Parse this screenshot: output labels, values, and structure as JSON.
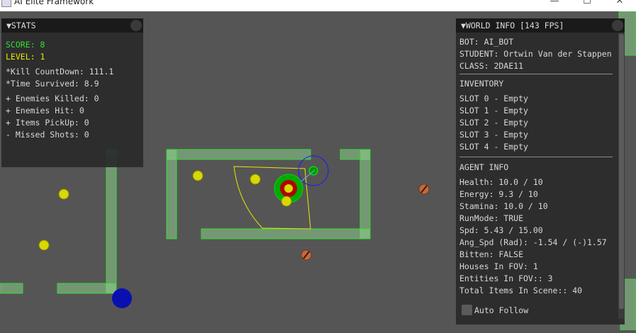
{
  "window": {
    "title": "AI Elite Framework",
    "minimize": "—",
    "maximize": "☐",
    "close": "✕"
  },
  "stats": {
    "header": "▼STATS",
    "score": "SCORE: 8",
    "level": "LEVEL: 1",
    "kill_countdown": "*Kill CountDown: 111.1",
    "time_survived": "*Time Survived: 8.9",
    "enemies_killed": "+ Enemies Killed: 0",
    "enemies_hit": "+ Enemies Hit: 0",
    "items_pickup": "+ Items PickUp: 0",
    "missed_shots": "- Missed Shots: 0"
  },
  "world": {
    "header": "▼WORLD INFO [143 FPS]",
    "bot": "BOT: AI_BOT",
    "student": "STUDENT: Ortwin Van der Stappen",
    "class": "CLASS: 2DAE11",
    "inventory_title": "INVENTORY",
    "slots": [
      "SLOT 0 - Empty",
      "SLOT 1 - Empty",
      "SLOT 2 - Empty",
      "SLOT 3 - Empty",
      "SLOT 4 - Empty"
    ],
    "agent_title": "AGENT INFO",
    "health": "Health: 10.0 / 10",
    "energy": "Energy: 9.3 / 10",
    "stamina": "Stamina: 10.0 / 10",
    "runmode": "RunMode: TRUE",
    "spd": "Spd: 5.43 / 15.00",
    "ang_spd": "Ang_Spd (Rad): -1.54 / (-)1.57",
    "bitten": "Bitten: FALSE",
    "houses_fov": "Houses In FOV: 1",
    "entities_fov": "Entities In FOV:: 3",
    "total_items": "Total Items In Scene:: 40",
    "auto_follow": "Auto Follow"
  },
  "colors": {
    "background": "#555555",
    "wall_fill": "#8ecf8e",
    "wall_stroke": "#33dd33",
    "item": "#d8d800",
    "enemy": "#c46a3c",
    "agent_outer": "#00aa00",
    "agent_inner": "#b00000",
    "fov_cone": "#e8e800",
    "steering_circle": "#1a1aff",
    "player_blue": "#0a10b0",
    "score_color": "#33dd33",
    "level_color": "#e8e800"
  }
}
